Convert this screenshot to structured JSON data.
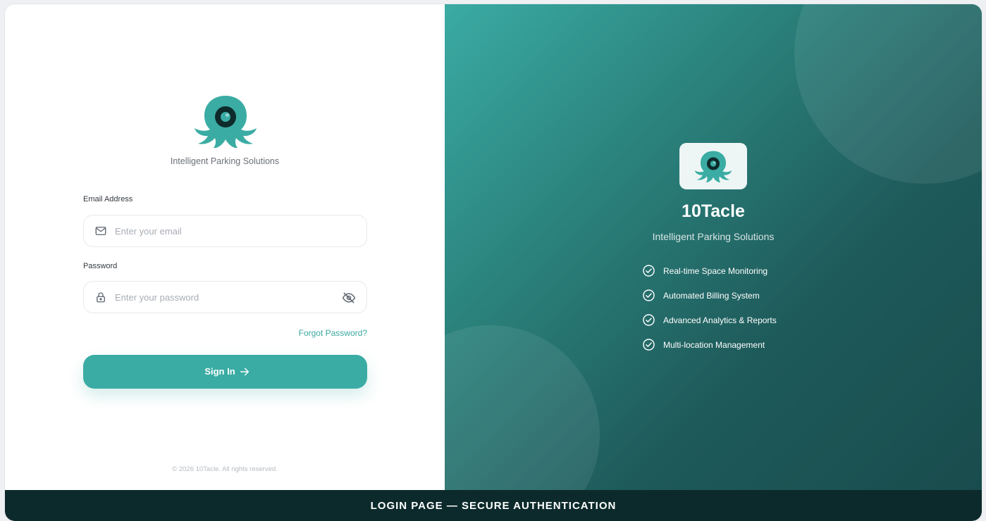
{
  "login": {
    "tagline": "Intelligent Parking Solutions",
    "email": {
      "label": "Email Address",
      "placeholder": "Enter your email"
    },
    "password": {
      "label": "Password",
      "placeholder": "Enter your password"
    },
    "forgot": "Forgot Password?",
    "submit": "Sign In",
    "copyright": "© 2026 10Tacle. All rights reserved."
  },
  "brand": {
    "name": "10Tacle",
    "tagline": "Intelligent Parking Solutions",
    "features": [
      "Real-time Space Monitoring",
      "Automated Billing System",
      "Advanced Analytics & Reports",
      "Multi-location Management"
    ]
  },
  "footer": {
    "caption": "LOGIN PAGE — SECURE AUTHENTICATION"
  },
  "colors": {
    "accent": "#3aaca3",
    "dark": "#0c2a2b",
    "panel_end": "#194c4d"
  },
  "icons": [
    "octopus-logo-icon",
    "mail-icon",
    "lock-icon",
    "eye-off-icon",
    "arrow-right-icon",
    "check-circle-icon"
  ]
}
